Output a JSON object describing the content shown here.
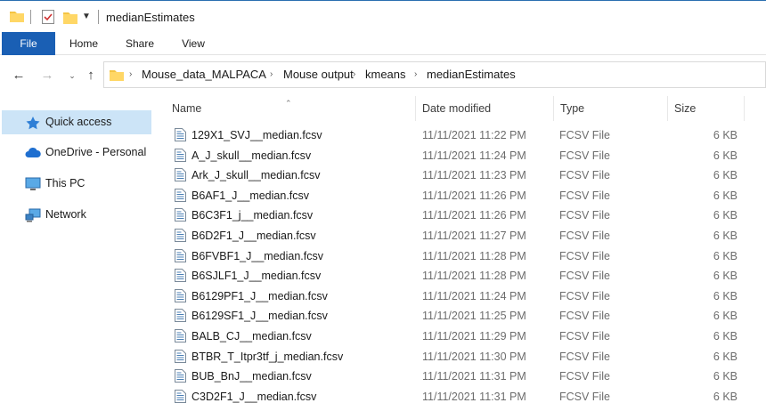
{
  "window": {
    "title": "medianEstimates"
  },
  "ribbon": {
    "tabs": [
      "File",
      "Home",
      "Share",
      "View"
    ]
  },
  "address": {
    "crumbs": [
      "Mouse_data_MALPACA",
      "Mouse output",
      "kmeans",
      "medianEstimates"
    ]
  },
  "sidebar": {
    "items": [
      {
        "label": "Quick access",
        "icon": "star-icon"
      },
      {
        "label": "OneDrive - Personal",
        "icon": "cloud-icon"
      },
      {
        "label": "This PC",
        "icon": "monitor-icon"
      },
      {
        "label": "Network",
        "icon": "network-icon"
      }
    ]
  },
  "columns": [
    "Name",
    "Date modified",
    "Type",
    "Size"
  ],
  "files": [
    {
      "name": "129X1_SVJ__median.fcsv",
      "date": "11/11/2021 11:22 PM",
      "type": "FCSV File",
      "size": "6 KB"
    },
    {
      "name": "A_J_skull__median.fcsv",
      "date": "11/11/2021 11:24 PM",
      "type": "FCSV File",
      "size": "6 KB"
    },
    {
      "name": "Ark_J_skull__median.fcsv",
      "date": "11/11/2021 11:23 PM",
      "type": "FCSV File",
      "size": "6 KB"
    },
    {
      "name": "B6AF1_J__median.fcsv",
      "date": "11/11/2021 11:26 PM",
      "type": "FCSV File",
      "size": "6 KB"
    },
    {
      "name": "B6C3F1_j__median.fcsv",
      "date": "11/11/2021 11:26 PM",
      "type": "FCSV File",
      "size": "6 KB"
    },
    {
      "name": "B6D2F1_J__median.fcsv",
      "date": "11/11/2021 11:27 PM",
      "type": "FCSV File",
      "size": "6 KB"
    },
    {
      "name": "B6FVBF1_J__median.fcsv",
      "date": "11/11/2021 11:28 PM",
      "type": "FCSV File",
      "size": "6 KB"
    },
    {
      "name": "B6SJLF1_J__median.fcsv",
      "date": "11/11/2021 11:28 PM",
      "type": "FCSV File",
      "size": "6 KB"
    },
    {
      "name": "B6129PF1_J__median.fcsv",
      "date": "11/11/2021 11:24 PM",
      "type": "FCSV File",
      "size": "6 KB"
    },
    {
      "name": "B6129SF1_J__median.fcsv",
      "date": "11/11/2021 11:25 PM",
      "type": "FCSV File",
      "size": "6 KB"
    },
    {
      "name": "BALB_CJ__median.fcsv",
      "date": "11/11/2021 11:29 PM",
      "type": "FCSV File",
      "size": "6 KB"
    },
    {
      "name": "BTBR_T_Itpr3tf_j_median.fcsv",
      "date": "11/11/2021 11:30 PM",
      "type": "FCSV File",
      "size": "6 KB"
    },
    {
      "name": "BUB_BnJ__median.fcsv",
      "date": "11/11/2021 11:31 PM",
      "type": "FCSV File",
      "size": "6 KB"
    },
    {
      "name": "C3D2F1_J__median.fcsv",
      "date": "11/11/2021 11:31 PM",
      "type": "FCSV File",
      "size": "6 KB"
    }
  ],
  "colors": {
    "accent": "#1a5fb4",
    "selection": "#cce4f7",
    "folder": "#f4c443"
  }
}
